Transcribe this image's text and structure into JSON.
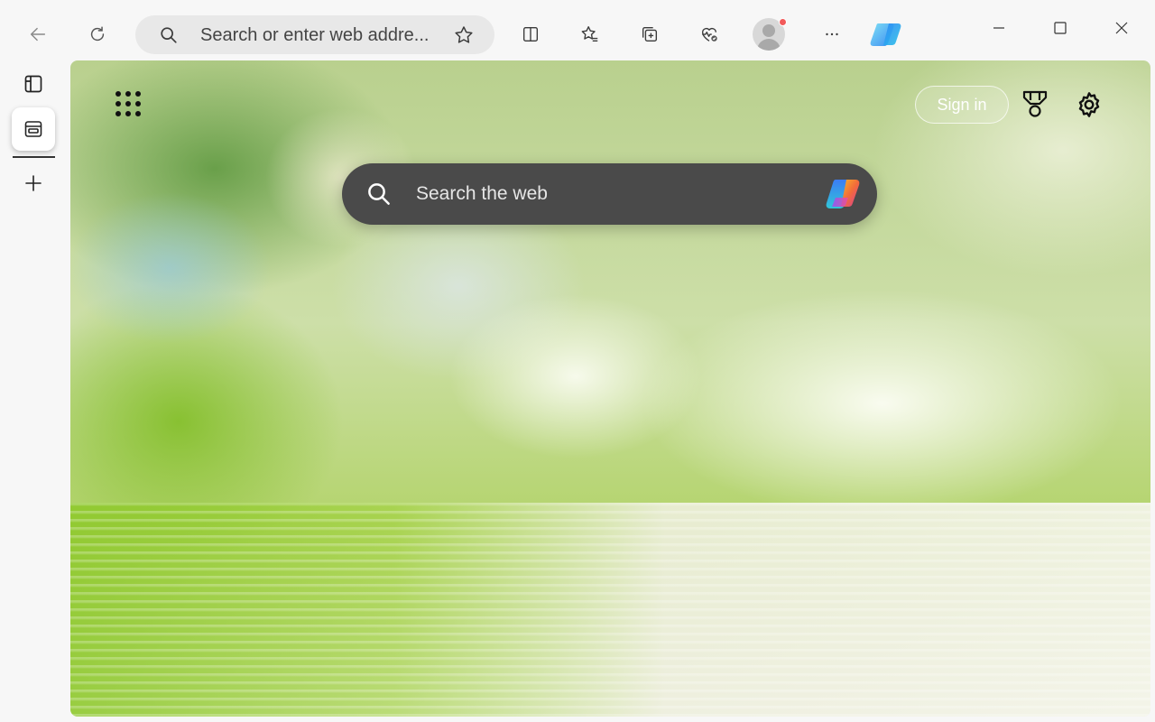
{
  "toolbar": {
    "back": "back-arrow-icon",
    "refresh": "refresh-icon",
    "address_placeholder": "Search or enter web address",
    "address_display": "Search or enter web addre...",
    "icons": [
      "split-screen-icon",
      "favorites-icon",
      "collections-icon",
      "browser-essentials-icon",
      "profile-avatar",
      "more-menu-icon",
      "copilot-icon"
    ],
    "profile_notification_color": "#f25a5a"
  },
  "window_controls": [
    "minimize-icon",
    "maximize-icon",
    "close-icon"
  ],
  "sidebar": {
    "items": [
      "tab-actions-icon",
      "new-tab-page-tab",
      "add-tab-icon"
    ]
  },
  "newtab": {
    "signin_label": "Sign in",
    "search_placeholder": "Search the web",
    "search_bar_color": "#4a4a4a"
  }
}
